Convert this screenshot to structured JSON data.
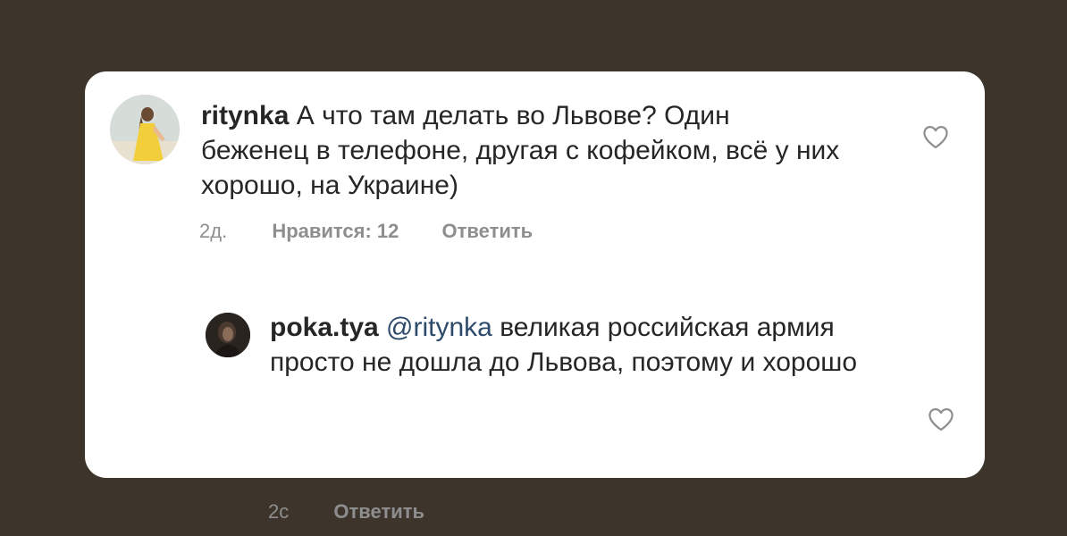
{
  "comments": [
    {
      "username": "ritynka",
      "text": " А что там делать во Львове? Один беженец в телефоне, другая с кофейком, всё у них хорошо, на Украине)",
      "time": "2д.",
      "likes": "Нравится: 12",
      "reply_label": "Ответить",
      "avatar_icon": "user-avatar-photo",
      "like_icon": "heart-outline-icon"
    },
    {
      "username": "poka.tya",
      "mention": " @ritynka",
      "text": " великая российская армия просто не дошла до Львова, поэтому и хорошо",
      "time": "2с",
      "reply_label": "Ответить",
      "avatar_icon": "user-avatar-photo",
      "like_icon": "heart-outline-icon"
    }
  ],
  "colors": {
    "background": "#3d352c",
    "card": "#ffffff",
    "text": "#262626",
    "meta": "#8e8e8e",
    "mention": "#2e4a6b"
  }
}
